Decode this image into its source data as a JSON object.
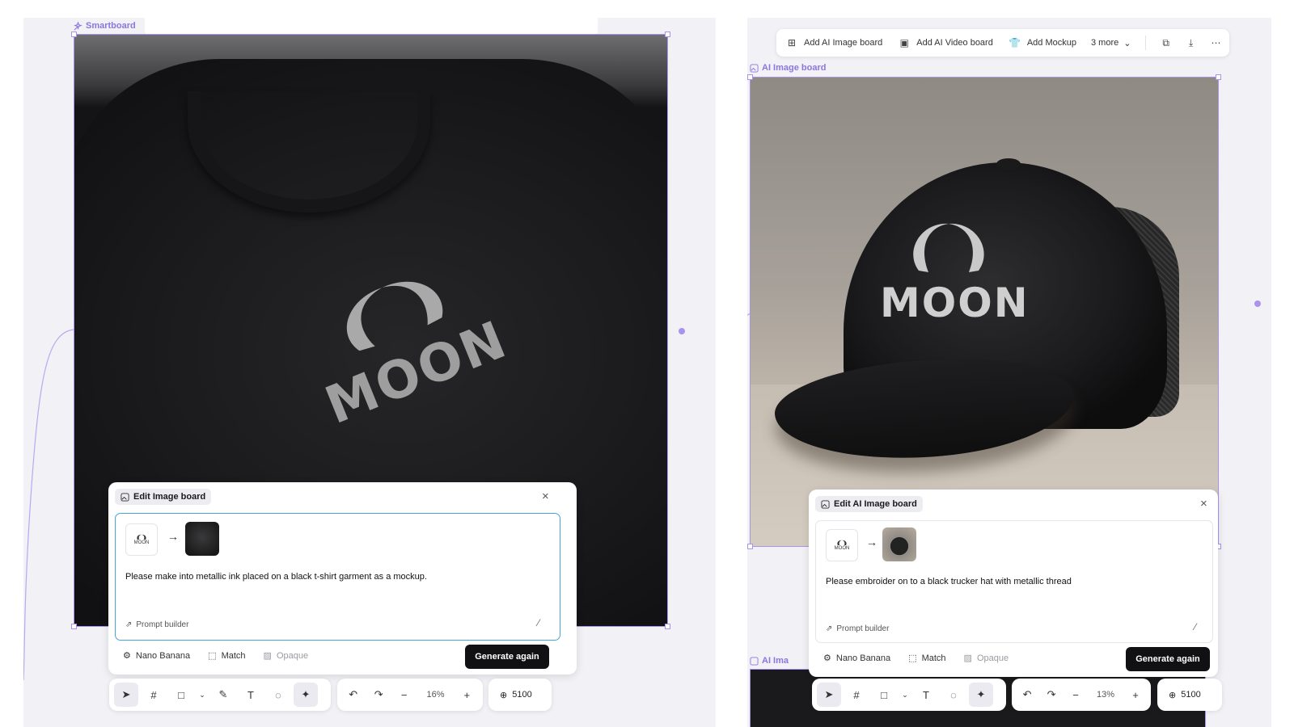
{
  "left": {
    "board_label": "Smartboard",
    "edit_panel": {
      "title": "Edit Image board",
      "prompt": "Please make into metallic ink placed on a black t-shirt garment as a mockup.",
      "prompt_builder": "Prompt builder",
      "logo_thumb": "MOON",
      "options": {
        "model": "Nano Banana",
        "match": "Match",
        "opaque": "Opaque"
      },
      "generate": "Generate again"
    },
    "toolbar": {
      "zoom": "16%",
      "credits": "5100"
    },
    "image_logo": "MOON"
  },
  "right": {
    "top_toolbar": {
      "add_ai_image": "Add AI Image board",
      "add_ai_video": "Add AI Video board",
      "add_mockup": "Add Mockup",
      "more": "3 more"
    },
    "board_label": "AI Image board",
    "lower_board_label": "AI Ima",
    "edit_panel": {
      "title": "Edit AI Image board",
      "prompt": "Please embroider on to a black trucker hat with metallic thread",
      "prompt_builder": "Prompt builder",
      "logo_thumb": "MOON",
      "options": {
        "model": "Nano Banana",
        "match": "Match",
        "opaque": "Opaque"
      },
      "generate": "Generate again"
    },
    "toolbar": {
      "zoom": "13%",
      "credits": "5100"
    },
    "image_logo": "MOON"
  },
  "colors": {
    "accent": "#a993ef",
    "label": "#8c76e0",
    "button": "#111113",
    "canvas": "#f1f1f6"
  }
}
